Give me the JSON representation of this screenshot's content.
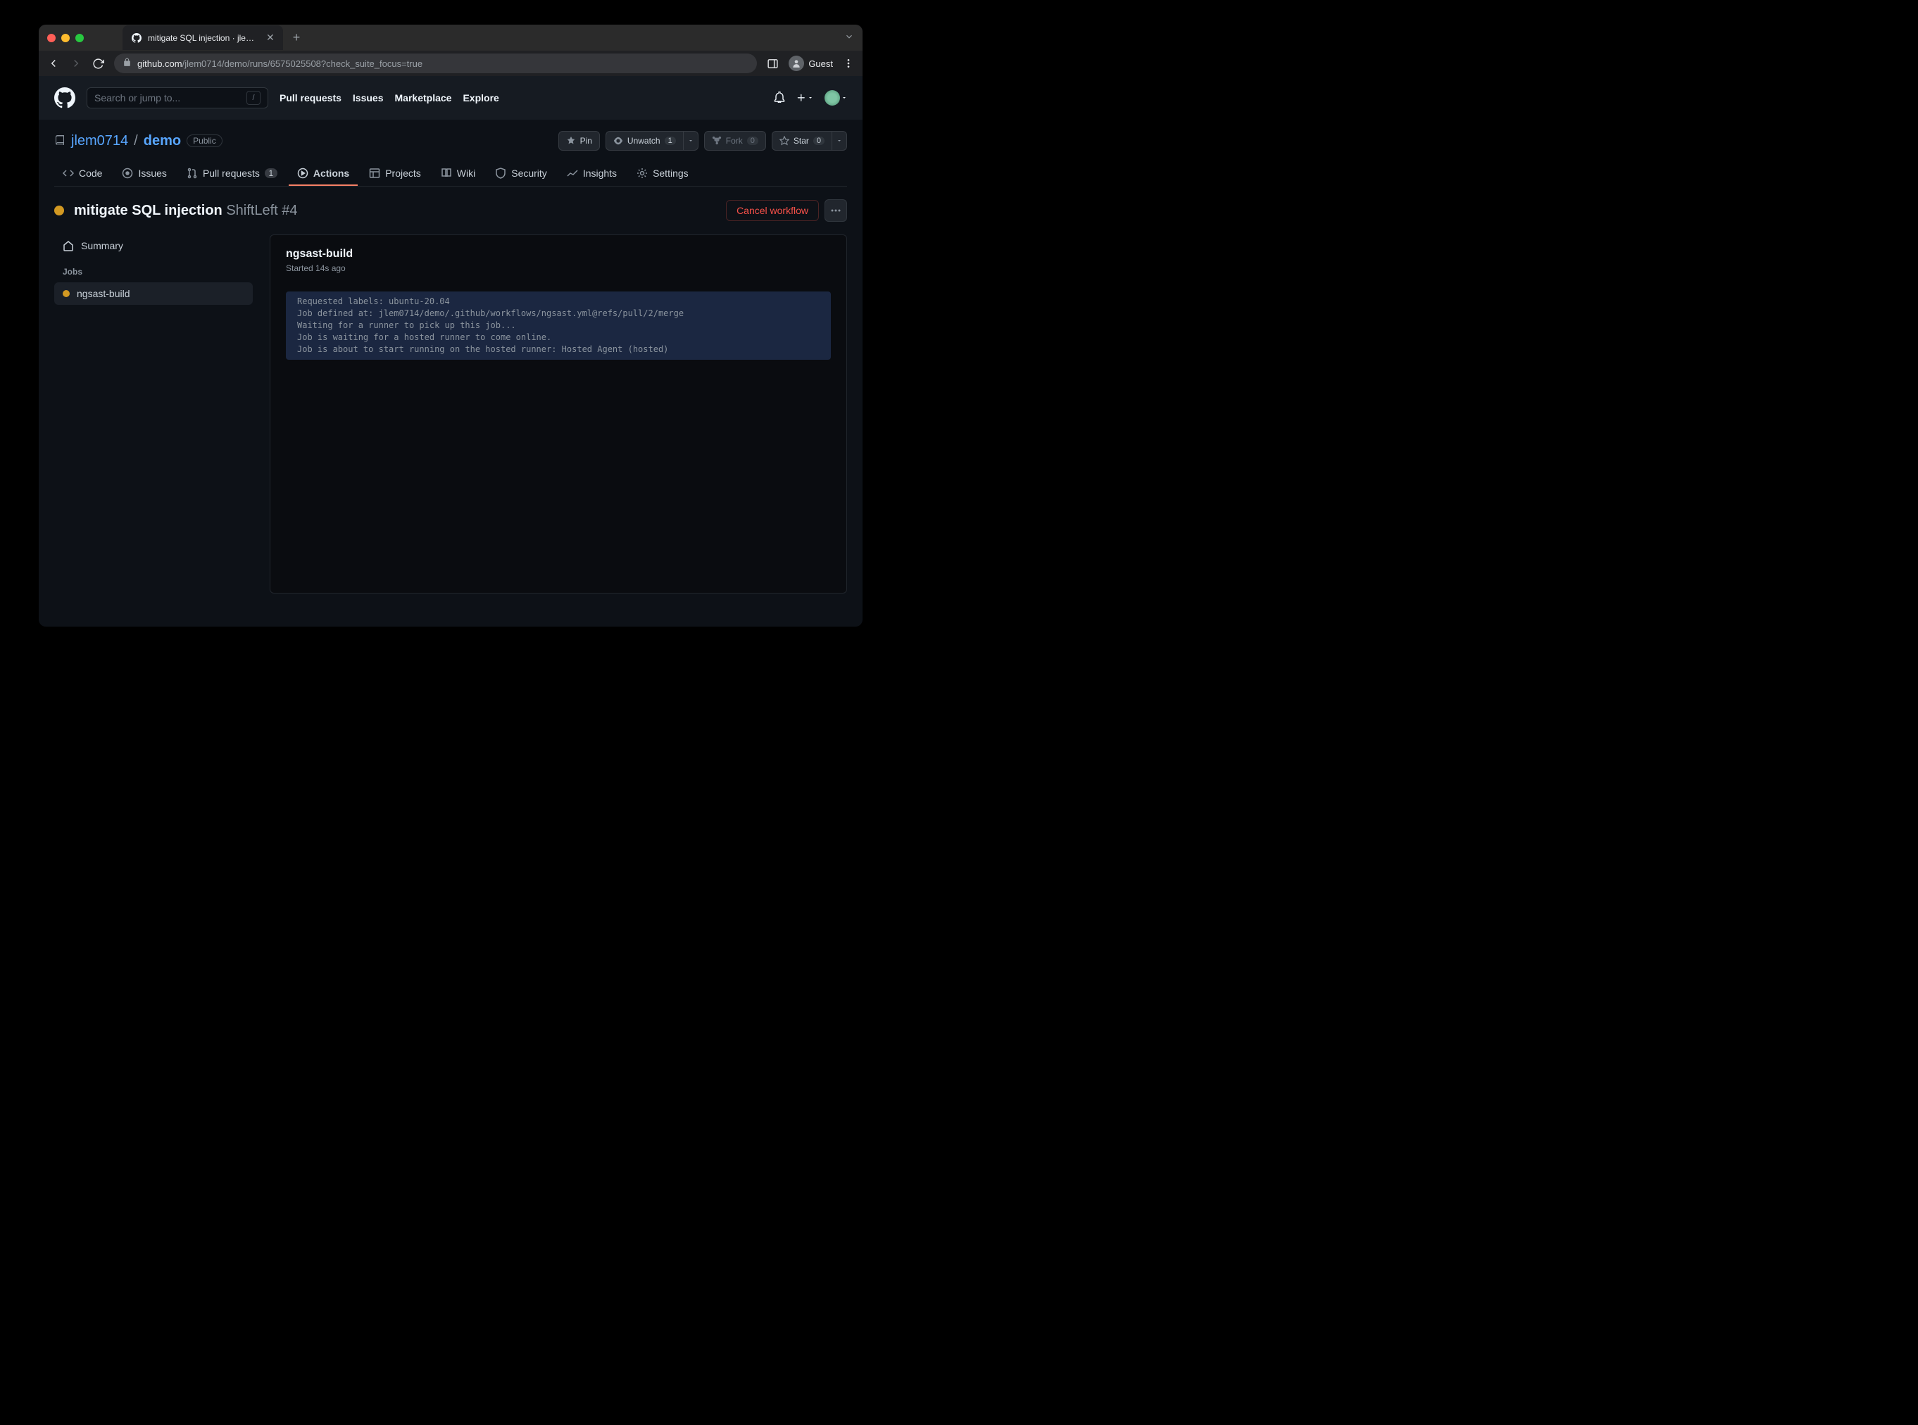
{
  "browser": {
    "tab_title": "mitigate SQL injection · jlem07",
    "url_host": "github.com",
    "url_path": "/jlem0714/demo/runs/6575025508?check_suite_focus=true",
    "guest_label": "Guest"
  },
  "header": {
    "search_placeholder": "Search or jump to...",
    "nav": {
      "pulls": "Pull requests",
      "issues": "Issues",
      "marketplace": "Marketplace",
      "explore": "Explore"
    }
  },
  "repo": {
    "owner": "jlem0714",
    "name": "demo",
    "visibility": "Public",
    "actions": {
      "pin": "Pin",
      "unwatch": "Unwatch",
      "watch_count": "1",
      "fork": "Fork",
      "fork_count": "0",
      "star": "Star",
      "star_count": "0"
    },
    "tabs": {
      "code": "Code",
      "issues": "Issues",
      "pulls": "Pull requests",
      "pulls_count": "1",
      "actions": "Actions",
      "projects": "Projects",
      "wiki": "Wiki",
      "security": "Security",
      "insights": "Insights",
      "settings": "Settings"
    }
  },
  "run": {
    "title": "mitigate SQL injection",
    "subtitle": "ShiftLeft #4",
    "cancel": "Cancel workflow"
  },
  "sidebar": {
    "summary": "Summary",
    "jobs_label": "Jobs",
    "job0": "ngsast-build"
  },
  "job": {
    "title": "ngsast-build",
    "started": "Started 14s ago",
    "log0": "Requested labels: ubuntu-20.04",
    "log1": "Job defined at: jlem0714/demo/.github/workflows/ngsast.yml@refs/pull/2/merge",
    "log2": "Waiting for a runner to pick up this job...",
    "log3": "Job is waiting for a hosted runner to come online.",
    "log4": "Job is about to start running on the hosted runner: Hosted Agent (hosted)"
  }
}
